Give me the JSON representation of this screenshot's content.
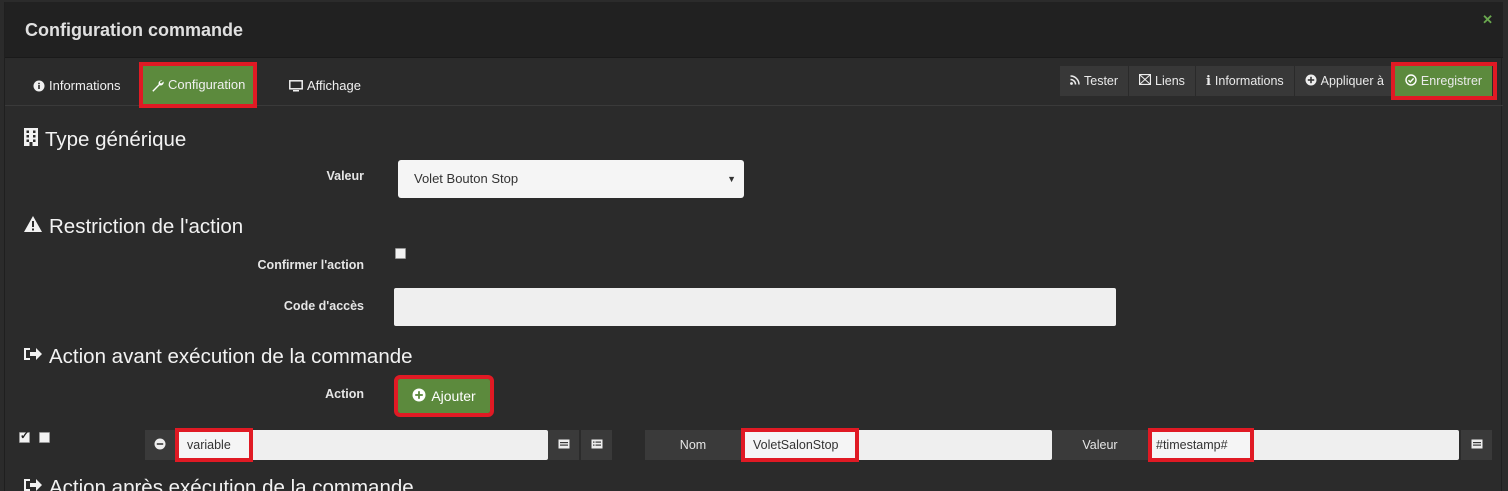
{
  "modal": {
    "title": "Configuration commande",
    "close_icon": "close-icon"
  },
  "tabs": [
    {
      "label": "Informations",
      "icon": "info-circle-icon",
      "active": false
    },
    {
      "label": "Configuration",
      "icon": "wrench-icon",
      "active": true
    },
    {
      "label": "Affichage",
      "icon": "monitor-icon",
      "active": false
    }
  ],
  "toolbar": {
    "tester": "Tester",
    "liens": "Liens",
    "informations": "Informations",
    "appliquer": "Appliquer à",
    "enregistrer": "Enregistrer"
  },
  "generic_type": {
    "title": "Type générique",
    "value_label": "Valeur",
    "value": "Volet Bouton Stop"
  },
  "restriction": {
    "title": "Restriction de l'action",
    "confirm_label": "Confirmer l'action",
    "confirm_checked": false,
    "code_label": "Code d'accès",
    "code_value": ""
  },
  "action_before": {
    "title": "Action avant exécution de la commande",
    "action_label": "Action",
    "add_button": "Ajouter",
    "row": {
      "enabled_checked": true,
      "parallel_checked": false,
      "command": "variable",
      "nom_label": "Nom",
      "nom_value": "VoletSalonStop",
      "valeur_label": "Valeur",
      "valeur_value": "#timestamp#"
    }
  },
  "action_after": {
    "title": "Action après exécution de la commande"
  },
  "colors": {
    "accent_green": "#5c8a3d",
    "highlight_red": "#e01a24",
    "background": "#2b2b2b"
  }
}
